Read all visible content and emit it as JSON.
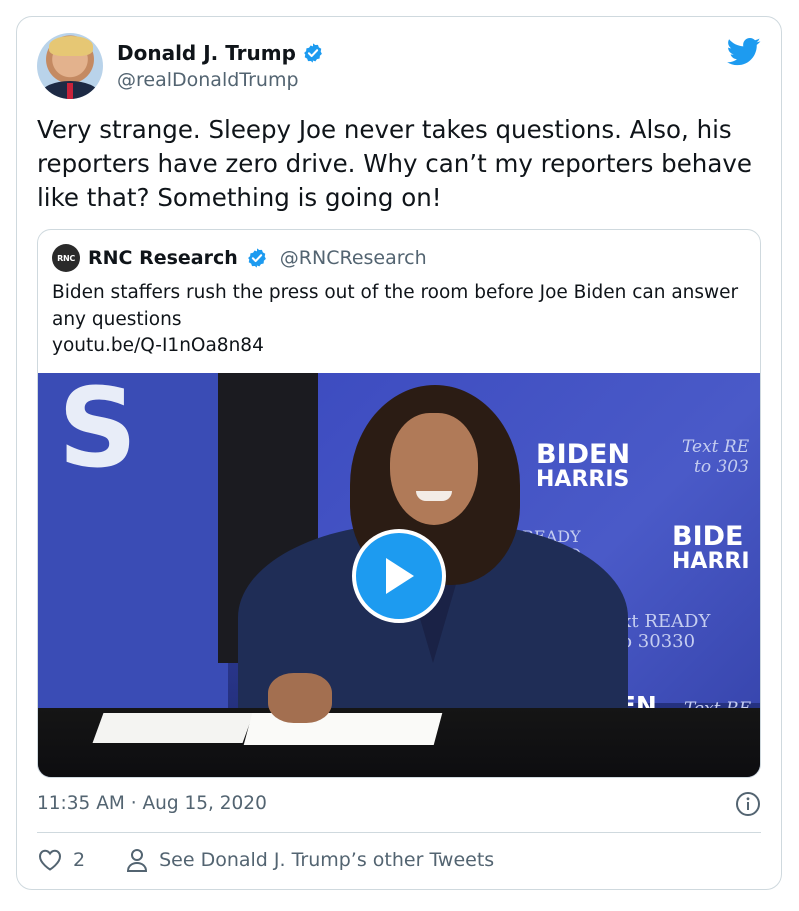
{
  "author": {
    "name": "Donald J. Trump",
    "handle": "@realDonaldTrump"
  },
  "tweet": {
    "text": "Very strange. Sleepy Joe never takes questions. Also, his reporters have zero drive. Why can’t my reporters behave like that? Something is going on!"
  },
  "quoted": {
    "avatar_text": "RNC",
    "name": "RNC Research",
    "handle": "@RNCResearch",
    "text": "Biden staffers rush the press out of the room before Joe Biden can answer any questions",
    "link": "youtu.be/Q-I1nOa8n84",
    "media": {
      "signs": {
        "biden": "BIDEN",
        "harris": "HARRIS",
        "biden2": "BIDE",
        "harris2": "HARRI",
        "den": "DEN",
        "text_re_1": "Text RE",
        "to_303": "to 303",
        "text_ready": "Text READY",
        "to_30330": "to 30330",
        "text_re_2": "Text RE",
        "s_letter": "S",
        "eady": "READY",
        "o_fragment": "O"
      }
    }
  },
  "meta": {
    "timestamp": "11:35 AM · Aug 15, 2020"
  },
  "actions": {
    "likes": "2",
    "other_tweets": "See Donald J. Trump’s other Tweets"
  },
  "colors": {
    "accent": "#1d9bf0",
    "secondary_text": "#536471",
    "border": "#cfd9de"
  },
  "icons": [
    "verified-badge-icon",
    "twitter-bird-icon",
    "play-icon",
    "info-icon",
    "heart-icon",
    "person-icon"
  ]
}
